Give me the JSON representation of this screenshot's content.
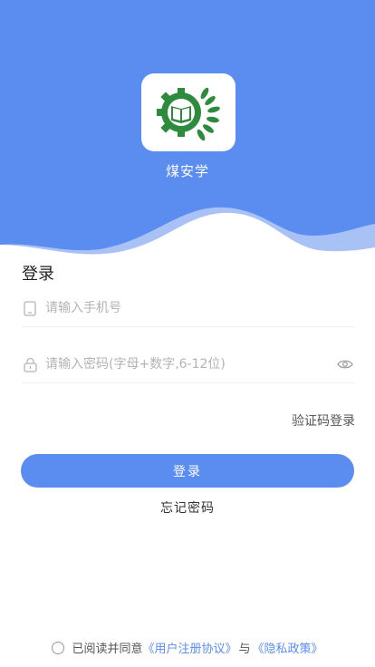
{
  "app": {
    "name": "煤安学"
  },
  "login": {
    "title": "登录",
    "phone_placeholder": "请输入手机号",
    "password_placeholder": "请输入密码(字母+数字,6-12位)",
    "code_login_label": "验证码登录",
    "submit_label": "登录",
    "forgot_label": "忘记密码"
  },
  "agreement": {
    "prefix": "已阅读并同意",
    "user_agreement": "《用户注册协议》",
    "conjunction": "与",
    "privacy_policy": "《隐私政策》"
  },
  "icons": {
    "phone": "phone-icon",
    "lock": "lock-icon",
    "eye": "eye-icon",
    "logo": "book-gear-logo"
  },
  "colors": {
    "accent": "#5b8cf0",
    "logo_green": "#2e8b3d"
  }
}
